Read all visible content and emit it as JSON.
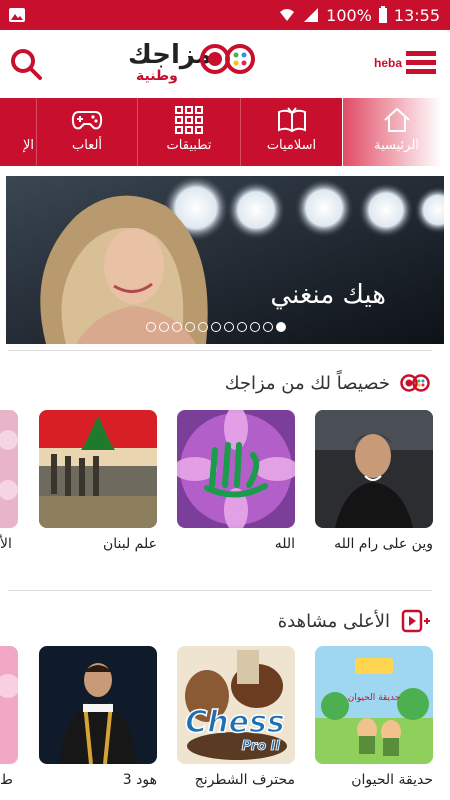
{
  "status_bar": {
    "battery": "100%",
    "time": "13:55"
  },
  "header": {
    "logo_main": "مزاجك",
    "logo_sub": "وطنية",
    "username": "heba"
  },
  "categories": [
    {
      "label": "الرئيسية",
      "icon": "home-icon",
      "active": true
    },
    {
      "label": "اسلاميات",
      "icon": "quran-icon",
      "active": false
    },
    {
      "label": "تطبيقات",
      "icon": "apps-grid-icon",
      "active": false
    },
    {
      "label": "ألعاب",
      "icon": "gamepad-icon",
      "active": false
    },
    {
      "label": "الإ",
      "icon": "",
      "active": false
    }
  ],
  "banner": {
    "caption": "هيك منغني",
    "dot_count": 11,
    "active_dot": 10
  },
  "sections": [
    {
      "title": "خصيصاً لك من مزاجك",
      "icon": "mazajak-icon",
      "items": [
        {
          "title": "وين على رام الله"
        },
        {
          "title": "الله"
        },
        {
          "title": "علم لبنان"
        },
        {
          "title": "الأ"
        }
      ]
    },
    {
      "title": "الأعلى مشاهدة",
      "icon": "video-icon",
      "items": [
        {
          "title": "حديقة الحيوان"
        },
        {
          "title": "محترف الشطرنج"
        },
        {
          "title": "هود 3"
        },
        {
          "title": "ط"
        }
      ]
    }
  ],
  "thumb_texts": {
    "chess_big": "Chess",
    "chess_pro": "Pro II",
    "zoo": "حديقة الحيوان"
  },
  "colors": {
    "brand_red": "#c8102e",
    "white": "#ffffff"
  }
}
